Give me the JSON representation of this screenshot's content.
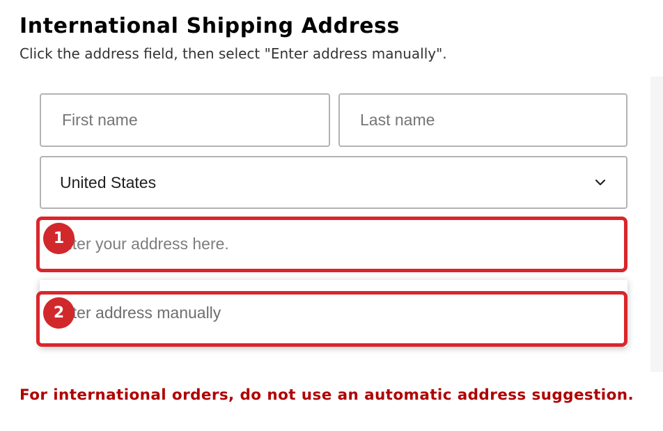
{
  "header": {
    "title": "International Shipping Address",
    "instruction": "Click the address field, then select \"Enter address manually\"."
  },
  "form": {
    "first_name_placeholder": "First name",
    "last_name_placeholder": "Last name",
    "country_value": "United States",
    "address_placeholder": "Enter your address here.",
    "address_visible_text": "nter your address here.",
    "dropdown_option": "Enter address manually",
    "dropdown_option_visible_text": "nter address manually"
  },
  "steps": {
    "step1": "1",
    "step2": "2"
  },
  "warning": "For international orders, do not use an automatic address suggestion.",
  "colors": {
    "highlight": "#d9262b",
    "warning": "#b00000",
    "field_border": "#b3b3b3"
  },
  "icons": {
    "country_select": "chevron-down-icon"
  }
}
